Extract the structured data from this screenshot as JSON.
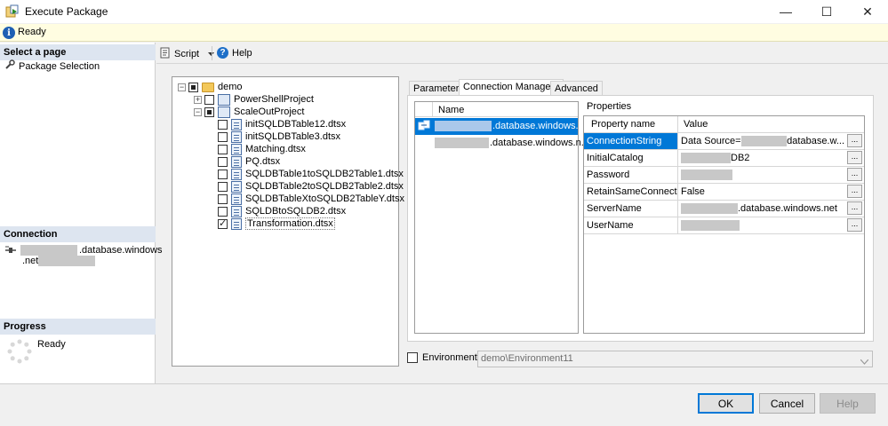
{
  "window": {
    "title": "Execute Package",
    "minimize": "—",
    "maximize": "☐",
    "close": "✕"
  },
  "status_bar": {
    "text": "Ready"
  },
  "left_panel": {
    "select_page_header": "Select a page",
    "pages": [
      {
        "label": "Package Selection"
      }
    ],
    "connection_header": "Connection",
    "connection_server_part1": ".database.windows",
    "connection_server_part2": ".net",
    "progress_header": "Progress",
    "progress_status": "Ready"
  },
  "toolbar": {
    "script_label": "Script",
    "help_label": "Help"
  },
  "tree": {
    "root": "demo",
    "projects": [
      {
        "label": "PowerShellProject"
      },
      {
        "label": "ScaleOutProject"
      }
    ],
    "packages": [
      {
        "label": "initSQLDBTable12.dtsx",
        "checked": false
      },
      {
        "label": "initSQLDBTable3.dtsx",
        "checked": false
      },
      {
        "label": "Matching.dtsx",
        "checked": false
      },
      {
        "label": "PQ.dtsx",
        "checked": false
      },
      {
        "label": "SQLDBTable1toSQLDB2Table1.dtsx",
        "checked": false
      },
      {
        "label": "SQLDBTable2toSQLDB2Table2.dtsx",
        "checked": false
      },
      {
        "label": "SQLDBTableXtoSQLDB2TableY.dtsx",
        "checked": false
      },
      {
        "label": "SQLDBtoSQLDB2.dtsx",
        "checked": false
      },
      {
        "label": "Transformation.dtsx",
        "checked": true
      }
    ]
  },
  "tabs": [
    {
      "label": "Parameters"
    },
    {
      "label": "Connection Managers"
    },
    {
      "label": "Advanced"
    }
  ],
  "connection_list": {
    "header": "Name",
    "rows": [
      {
        "suffix": ".database.windows....",
        "selected": true
      },
      {
        "suffix": ".database.windows.n...",
        "selected": false
      }
    ]
  },
  "properties": {
    "title": "Properties",
    "col_name": "Property name",
    "col_value": "Value",
    "rows": [
      {
        "name": "ConnectionString",
        "value_prefix": "Data Source=",
        "value_suffix": "database.w...",
        "selected": true
      },
      {
        "name": "InitialCatalog",
        "value_prefix": "",
        "value_suffix": "DB2",
        "selected": false
      },
      {
        "name": "Password",
        "value_prefix": "",
        "value_suffix": "",
        "selected": false
      },
      {
        "name": "RetainSameConnection",
        "value_prefix": "False",
        "value_suffix": "",
        "selected": false
      },
      {
        "name": "ServerName",
        "value_prefix": "",
        "value_suffix": ".database.windows.net",
        "selected": false
      },
      {
        "name": "UserName",
        "value_prefix": "",
        "value_suffix": "",
        "selected": false
      }
    ],
    "ellipsis": "..."
  },
  "environment": {
    "label": "Environment:",
    "value": "demo\\Environment11"
  },
  "buttons": {
    "ok": "OK",
    "cancel": "Cancel",
    "help": "Help"
  },
  "colors": {
    "selection": "#0078d7",
    "header_bg": "#dde5f0",
    "status_bg": "#fffde1"
  }
}
